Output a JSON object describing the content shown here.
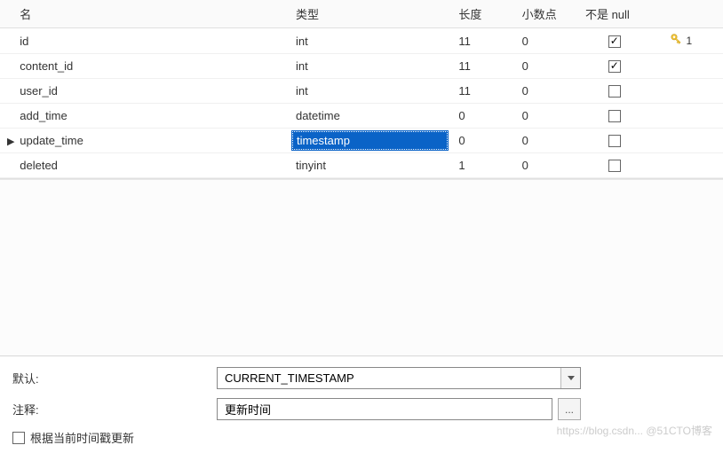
{
  "headers": {
    "name": "名",
    "type": "类型",
    "length": "长度",
    "decimals": "小数点",
    "not_null": "不是 null"
  },
  "rows": [
    {
      "name": "id",
      "type": "int",
      "length": "11",
      "decimals": "0",
      "not_null": true,
      "pk": true,
      "pk_num": "1",
      "current": false
    },
    {
      "name": "content_id",
      "type": "int",
      "length": "11",
      "decimals": "0",
      "not_null": true,
      "pk": false,
      "pk_num": "",
      "current": false
    },
    {
      "name": "user_id",
      "type": "int",
      "length": "11",
      "decimals": "0",
      "not_null": false,
      "pk": false,
      "pk_num": "",
      "current": false
    },
    {
      "name": "add_time",
      "type": "datetime",
      "length": "0",
      "decimals": "0",
      "not_null": false,
      "pk": false,
      "pk_num": "",
      "current": false
    },
    {
      "name": "update_time",
      "type": "timestamp",
      "length": "0",
      "decimals": "0",
      "not_null": false,
      "pk": false,
      "pk_num": "",
      "current": true
    },
    {
      "name": "deleted",
      "type": "tinyint",
      "length": "1",
      "decimals": "0",
      "not_null": false,
      "pk": false,
      "pk_num": "",
      "current": false
    }
  ],
  "detail": {
    "default_label": "默认:",
    "default_value": "CURRENT_TIMESTAMP",
    "comment_label": "注释:",
    "comment_value": "更新时间",
    "on_update_label": "根据当前时间戳更新",
    "on_update_checked": false
  },
  "dots_label": "...",
  "watermark": "https://blog.csdn... @51CTO博客"
}
